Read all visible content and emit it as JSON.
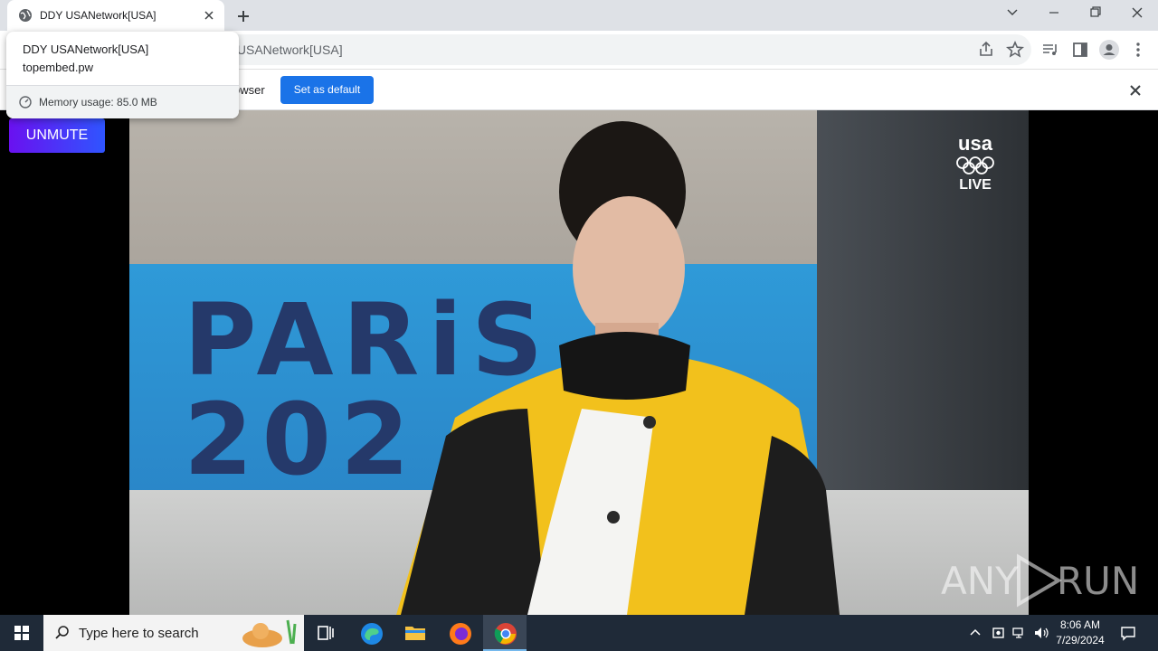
{
  "browser": {
    "tab": {
      "title": "DDY USANetwork[USA]",
      "favicon": "globe-icon",
      "close_icon": "close-icon"
    },
    "new_tab_icon": "plus-icon",
    "window_controls": [
      "chevron-down-icon",
      "minimize-icon",
      "restore-icon",
      "close-icon"
    ],
    "address_bar": {
      "url": "/USANetwork[USA]"
    },
    "toolbar_icons": [
      "share-icon",
      "star-icon",
      "media-icon",
      "side-panel-icon",
      "profile-icon",
      "menu-icon"
    ]
  },
  "hover_card": {
    "title": "DDY USANetwork[USA]",
    "domain": "topembed.pw",
    "memory": "Memory usage: 85.0 MB"
  },
  "infobar": {
    "message": "owser",
    "set_default_label": "Set as default"
  },
  "page": {
    "unmute_label": "UNMUTE",
    "video": {
      "network_logo": "usa",
      "live_label": "LIVE",
      "backdrop_text_1": "PARiS",
      "backdrop_text_2": "202"
    },
    "watermark": {
      "left": "ANY",
      "right": "RUN"
    }
  },
  "taskbar": {
    "search_placeholder": "Type here to search",
    "apps": [
      "task-view-icon",
      "edge-icon",
      "file-explorer-icon",
      "firefox-icon",
      "chrome-icon"
    ],
    "clock": {
      "time": "8:06 AM",
      "date": "7/29/2024"
    }
  },
  "colors": {
    "set_default_button": "#1a73e8",
    "unmute_gradient_start": "#6a11f0",
    "unmute_gradient_end": "#2f55ff",
    "taskbar": "#1f2a38"
  }
}
